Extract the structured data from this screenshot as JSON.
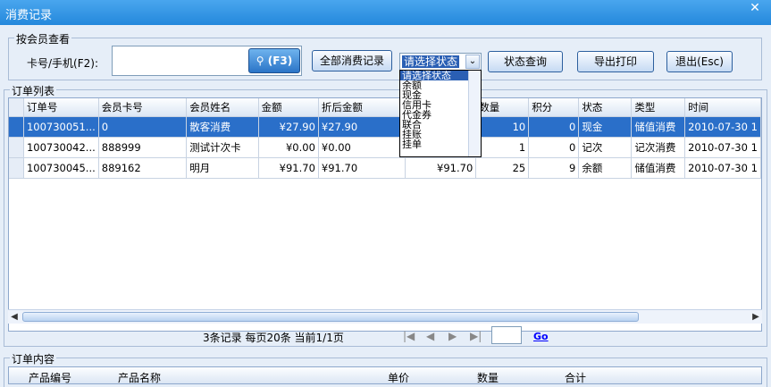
{
  "window": {
    "title": "消费记录",
    "close_glyph": "✕"
  },
  "search": {
    "legend": "按会员查看",
    "label": "卡号/手机(F2):",
    "input_value": "",
    "search_button": "(F3)",
    "all_button": "全部消费记录",
    "status_selected": "请选择状态",
    "status_options": [
      "请选择状态",
      "余额",
      "现金",
      "信用卡",
      "代金券",
      "联合",
      "挂账",
      "挂单"
    ],
    "status_query_button": "状态查询",
    "export_button": "导出打印",
    "exit_button": "退出(Esc)"
  },
  "orders": {
    "legend": "订单列表",
    "columns": [
      "订单号",
      "会员卡号",
      "会员姓名",
      "金额",
      "折后金额",
      "",
      "数量",
      "积分",
      "状态",
      "类型",
      "时间"
    ],
    "rows": [
      [
        "100730051...",
        "0",
        "散客消费",
        "¥27.90",
        "¥27.90",
        "",
        "10",
        "0",
        "现金",
        "储值消费",
        "2010-07-30 1"
      ],
      [
        "100730042...",
        "888999",
        "测试计次卡",
        "¥0.00",
        "¥0.00",
        "",
        "1",
        "0",
        "记次",
        "记次消费",
        "2010-07-30 1"
      ],
      [
        "100730045...",
        "889162",
        "明月",
        "¥91.70",
        "¥91.70",
        "¥91.70",
        "25",
        "9",
        "余额",
        "储值消费",
        "2010-07-30 1"
      ]
    ]
  },
  "pager": {
    "summary": "3条记录  每页20条  当前1/1页",
    "page_input": "",
    "go": "Go",
    "first": "|◀",
    "prev": "◀",
    "next": "▶",
    "last": "▶|"
  },
  "details": {
    "legend": "订单内容",
    "columns": [
      "产品编号",
      "产品名称",
      "单价",
      "数量",
      "合计"
    ]
  },
  "colors": {
    "titlebar": "#2488dc",
    "selected_row": "#2a6fc9",
    "window_bg": "#e6eef8"
  }
}
